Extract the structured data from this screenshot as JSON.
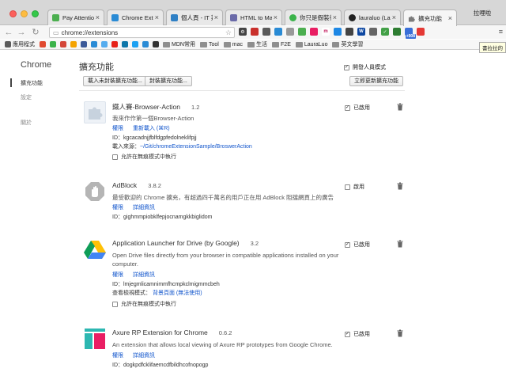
{
  "window": {
    "profile_name": "拉哩啦"
  },
  "tabs": [
    {
      "title": "Pay Attention",
      "active": false,
      "fav_color": "#4caf50"
    },
    {
      "title": "Chrome Exter",
      "active": false,
      "fav_color": "#2a8bd5"
    },
    {
      "title": "個人頁 - IT 邦",
      "active": false,
      "fav_color": "#2f80c5"
    },
    {
      "title": "HTML to Mar",
      "active": false,
      "fav_color": "#6a6aa8"
    },
    {
      "title": "你只是假裝很",
      "active": false,
      "fav_color": "#3bb34a"
    },
    {
      "title": "lauraluo (Lau",
      "active": false,
      "fav_color": "#222222"
    },
    {
      "title": "擴充功能",
      "active": true,
      "fav_color": "#888888"
    }
  ],
  "toolbar": {
    "url": "chrome://extensions"
  },
  "bookmarks": {
    "items": [
      {
        "label": "應用程式",
        "type": "apps",
        "color": "#5a5a5a"
      },
      {
        "label": "",
        "type": "icon",
        "color": "#e0492f"
      },
      {
        "label": "",
        "type": "icon",
        "color": "#3bb34a"
      },
      {
        "label": "",
        "type": "icon",
        "color": "#d44638"
      },
      {
        "label": "",
        "type": "icon",
        "color": "#f4a300"
      },
      {
        "label": "",
        "type": "icon",
        "color": "#3b5998"
      },
      {
        "label": "",
        "type": "icon",
        "color": "#2a8bd5"
      },
      {
        "label": "",
        "type": "icon",
        "color": "#55acee"
      },
      {
        "label": "",
        "type": "icon",
        "color": "#e62117"
      },
      {
        "label": "",
        "type": "icon",
        "color": "#0e76a8"
      },
      {
        "label": "",
        "type": "icon",
        "color": "#1da1f2"
      },
      {
        "label": "",
        "type": "icon",
        "color": "#2a8bd5"
      },
      {
        "label": "",
        "type": "icon",
        "color": "#333333"
      },
      {
        "label": "MDN常用",
        "type": "folder"
      },
      {
        "label": "Tool",
        "type": "folder"
      },
      {
        "label": "mac",
        "type": "folder"
      },
      {
        "label": "生活",
        "type": "folder"
      },
      {
        "label": "F2E",
        "type": "folder"
      },
      {
        "label": "LauraLuo",
        "type": "folder"
      },
      {
        "label": "英文學習",
        "type": "folder"
      }
    ],
    "more": "»",
    "other": "其"
  },
  "tooltip": "書拉拉的",
  "sidebar": {
    "title": "Chrome",
    "items": [
      {
        "label": "擴充功能",
        "active": true
      },
      {
        "label": "設定",
        "active": false
      },
      {
        "label": "關於",
        "active": false
      }
    ]
  },
  "main": {
    "title": "擴充功能",
    "dev_mode_label": "開發人員模式",
    "dev_mode_checked": true,
    "load_unpacked_label": "載入未封裝擴充功能...",
    "pack_label": "封裝擴充功能...",
    "update_label": "立即更新擴充功能"
  },
  "extensions": [
    {
      "name": "鐵人賽-Browser-Action",
      "version": "1.2",
      "description": "我來作作第一個Browser-Action",
      "links": [
        "權限",
        "重新載入 (⌘R)"
      ],
      "id_label": "ID：",
      "id": "kgcacadnjjfblfdgpfedolneklifpjj",
      "source_label": "載入來源：",
      "source": "~/Git/chromeExtensionSample/BroswerAction",
      "incognito_label": "允許在無痕模式中執行",
      "enabled": true,
      "enabled_label": "已啟用",
      "logo": "puzzle-piece"
    },
    {
      "name": "AdBlock",
      "version": "3.8.2",
      "description": "最受歡迎的 Chrome 擴充，有超過四千萬名的用戶正在用 AdBlock 阻擋網頁上的廣告",
      "links": [
        "權限",
        "詳細資訊"
      ],
      "id_label": "ID：",
      "id": "gighmmpiobklfepjocnamgkkbiglidom",
      "enabled": false,
      "enabled_label": "啟用",
      "logo": "stop-hand"
    },
    {
      "name": "Application Launcher for Drive (by Google)",
      "version": "3.2",
      "description": "Open Drive files directly from your browser in compatible applications installed on your computer.",
      "links": [
        "權限",
        "詳細資訊"
      ],
      "id_label": "ID：",
      "id": "lmjegmlicamnimmfhcmpkclmigmmcbeh",
      "inspect_label": "查看檢視模式：",
      "inspect_link": "背景頁面 (無法使用)",
      "incognito_label": "允許在無痕模式中執行",
      "enabled": true,
      "enabled_label": "已啟用",
      "logo": "google-drive"
    },
    {
      "name": "Axure RP Extension for Chrome",
      "version": "0.6.2",
      "description": "An extension that allows local viewing of Axure RP prototypes from Google Chrome.",
      "links": [
        "權限",
        "詳細資訊"
      ],
      "id_label": "ID：",
      "id": "dogkpdfcklifaemcdfbildhcofnopogp",
      "enabled": true,
      "enabled_label": "已啟用",
      "logo": "axure"
    }
  ]
}
